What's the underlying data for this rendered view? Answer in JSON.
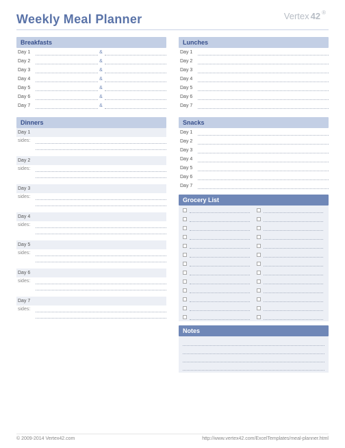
{
  "title": "Weekly Meal Planner",
  "logo": {
    "text": "Vertex",
    "num": "42"
  },
  "sections": {
    "breakfasts": "Breakfasts",
    "lunches": "Lunches",
    "dinners": "Dinners",
    "snacks": "Snacks",
    "grocery": "Grocery List",
    "notes": "Notes"
  },
  "days": [
    "Day 1",
    "Day 2",
    "Day 3",
    "Day 4",
    "Day 5",
    "Day 6",
    "Day 7"
  ],
  "amp": "&",
  "sides_label": "sides:",
  "grocery_bullet": "□",
  "footer": {
    "copyright": "© 2009-2014 Vertex42.com",
    "url": "http://www.vertex42.com/ExcelTemplates/meal-planner.html"
  }
}
